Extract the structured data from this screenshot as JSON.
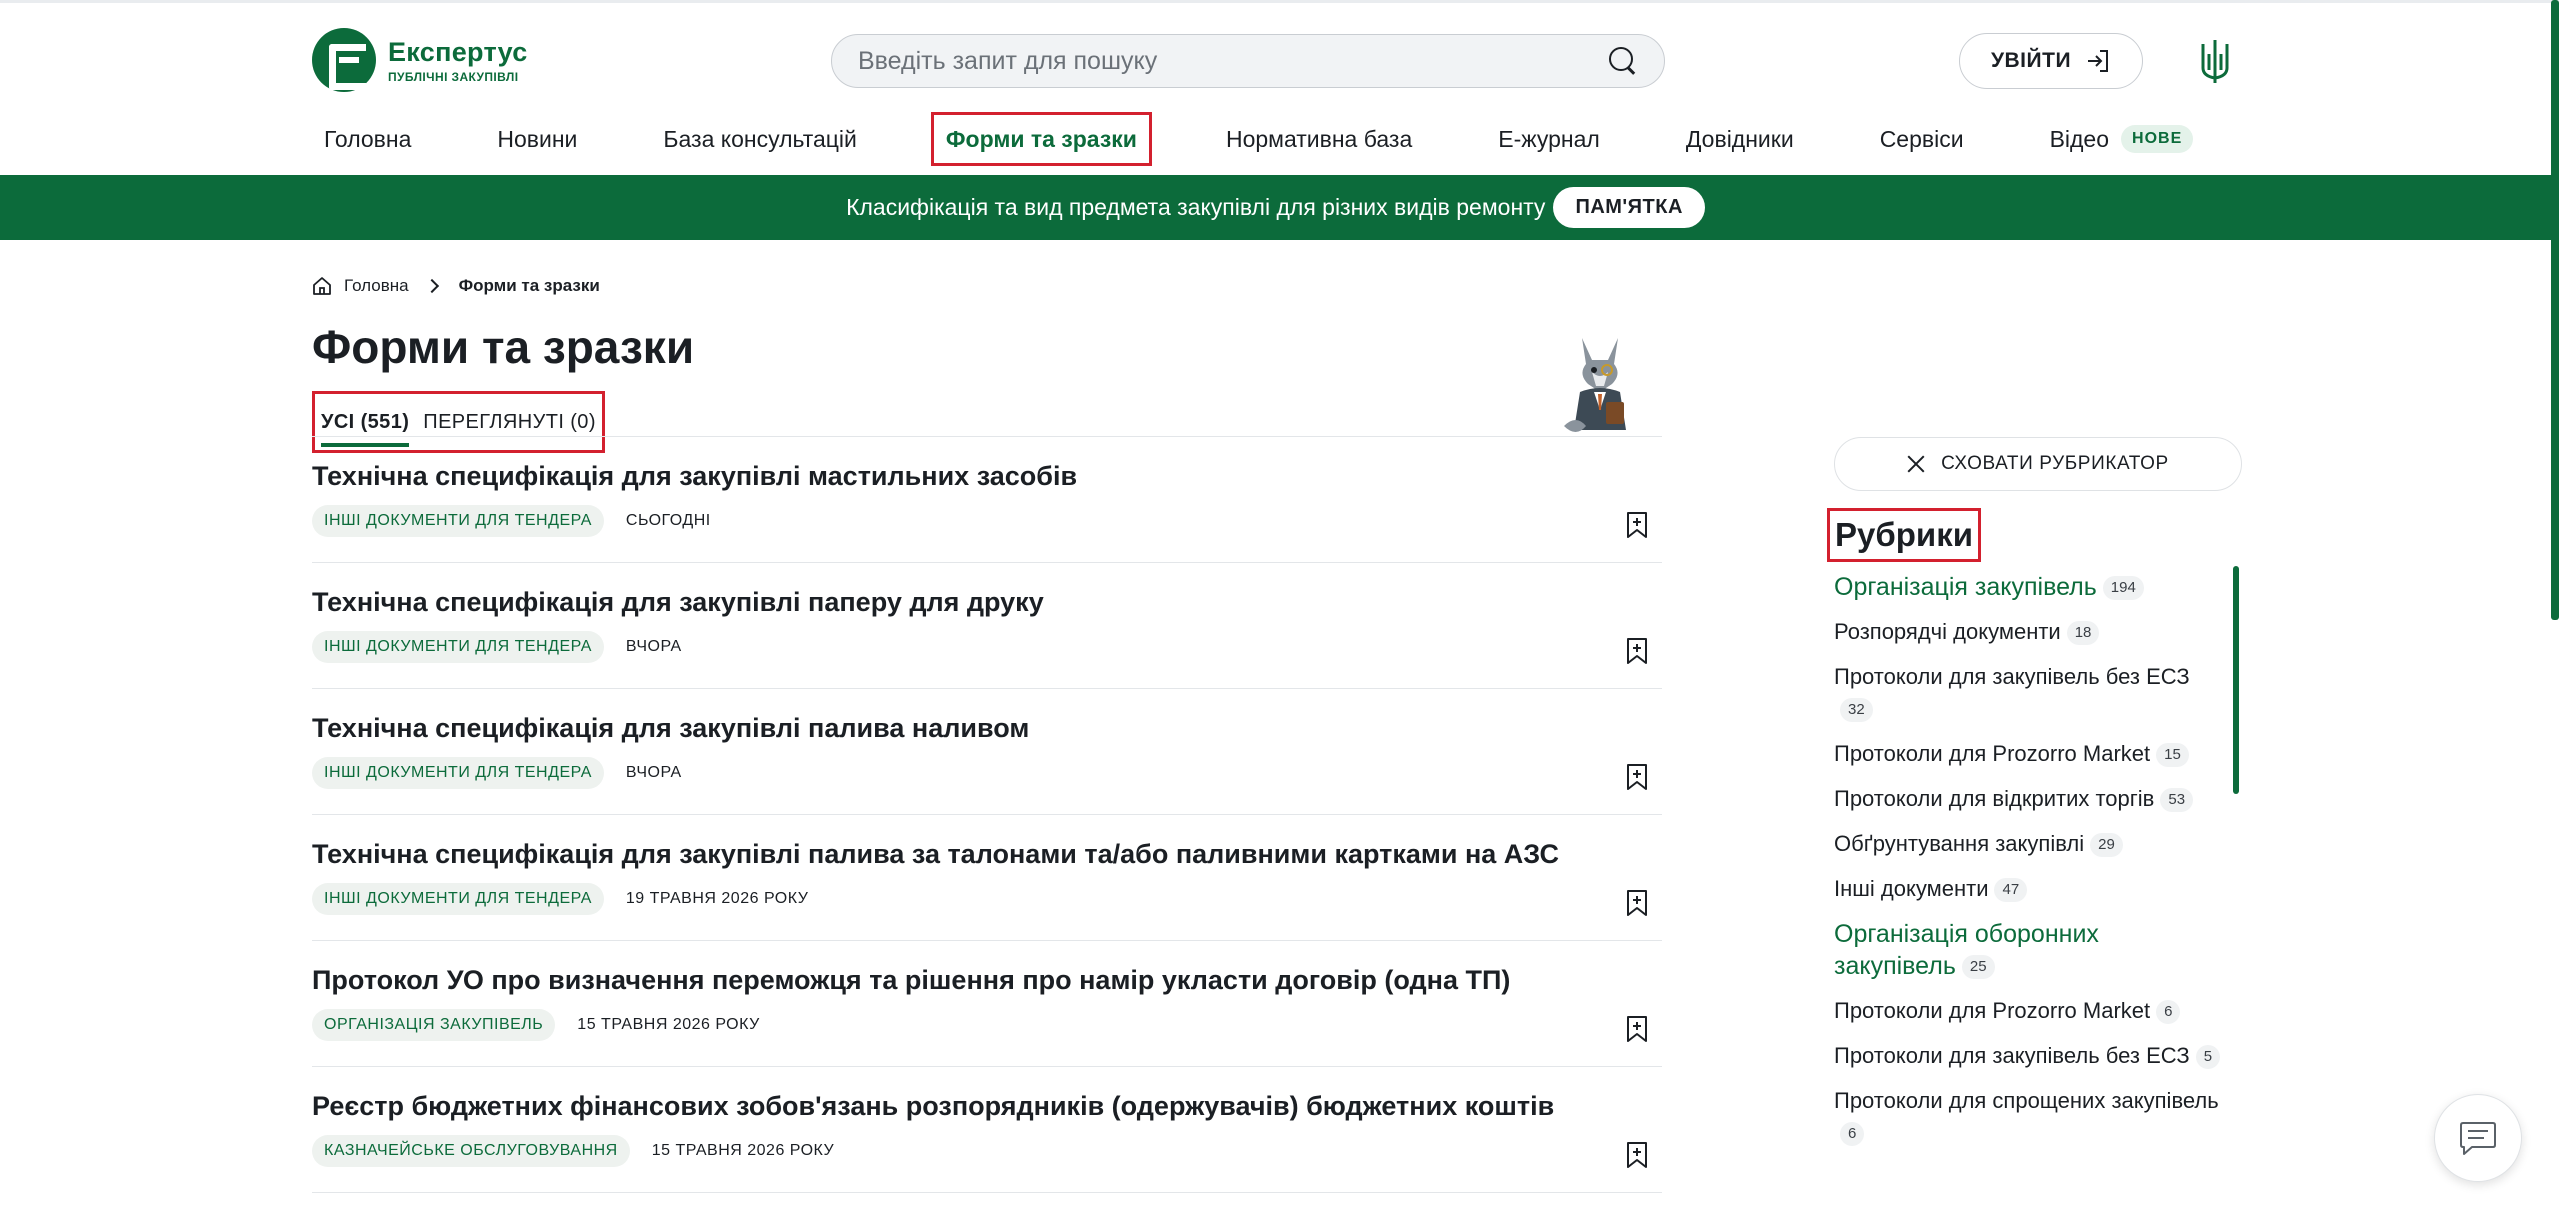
{
  "header": {
    "logo_title": "Експертус",
    "logo_subtitle": "ПУБЛІЧНІ ЗАКУПІВЛІ",
    "search_placeholder": "Введіть запит для пошуку",
    "login_label": "УВІЙТИ"
  },
  "nav": {
    "items": [
      "Головна",
      "Новини",
      "База консультацій",
      "Форми та зразки",
      "Нормативна база",
      "Е-журнал",
      "Довідники",
      "Сервіси",
      "Відео"
    ],
    "active_index": 3,
    "video_badge": "НОВЕ"
  },
  "banner": {
    "text": "Класифікація та вид предмета закупівлі для різних видів ремонту",
    "button": "ПАМ'ЯТКА"
  },
  "breadcrumb": {
    "home": "Головна",
    "current": "Форми та зразки"
  },
  "page": {
    "title": "Форми та зразки"
  },
  "tabs": [
    {
      "label": "УСІ (551)",
      "active": true
    },
    {
      "label": "ПЕРЕГЛЯНУТІ (0)",
      "active": false
    }
  ],
  "list": [
    {
      "title": "Технічна специфікація для закупівлі мастильних засобів",
      "tag": "ІНШІ ДОКУМЕНТИ ДЛЯ ТЕНДЕРА",
      "date": "СЬОГОДНІ"
    },
    {
      "title": "Технічна специфікація для закупівлі паперу для друку",
      "tag": "ІНШІ ДОКУМЕНТИ ДЛЯ ТЕНДЕРА",
      "date": "ВЧОРА"
    },
    {
      "title": "Технічна специфікація для закупівлі палива наливом",
      "tag": "ІНШІ ДОКУМЕНТИ ДЛЯ ТЕНДЕРА",
      "date": "ВЧОРА"
    },
    {
      "title": "Технічна специфікація для закупівлі палива за талонами та/або паливними картками на АЗС",
      "tag": "ІНШІ ДОКУМЕНТИ ДЛЯ ТЕНДЕРА",
      "date": "19 ТРАВНЯ 2026 РОКУ"
    },
    {
      "title": "Протокол УО про визначення переможця та рішення про намір укласти договір (одна ТП)",
      "tag": "ОРГАНІЗАЦІЯ ЗАКУПІВЕЛЬ",
      "date": "15 ТРАВНЯ 2026 РОКУ"
    },
    {
      "title": "Реєстр бюджетних фінансових зобов'язань розпорядників (одержувачів) бюджетних коштів",
      "tag": "КАЗНАЧЕЙСЬКЕ ОБСЛУГОВУВАННЯ",
      "date": "15 ТРАВНЯ 2026 РОКУ"
    }
  ],
  "sidebar": {
    "hide_label": "СХОВАТИ РУБРИКАТОР",
    "title": "Рубрики",
    "rubrics": [
      {
        "label": "Організація закупівель",
        "count": "194",
        "category": true
      },
      {
        "label": "Розпорядчі документи",
        "count": "18",
        "category": false
      },
      {
        "label": "Протоколи для закупівель без ЕСЗ",
        "count": "32",
        "category": false
      },
      {
        "label": "Протоколи для Prozorro Market",
        "count": "15",
        "category": false
      },
      {
        "label": "Протоколи для відкритих торгів",
        "count": "53",
        "category": false
      },
      {
        "label": "Обґрунтування закупівлі",
        "count": "29",
        "category": false
      },
      {
        "label": "Інші документи",
        "count": "47",
        "category": false
      },
      {
        "label": "Організація оборонних закупівель",
        "count": "25",
        "category": true
      },
      {
        "label": "Протоколи для Prozorro Market",
        "count": "6",
        "category": false
      },
      {
        "label": "Протоколи для закупівель без ЕСЗ",
        "count": "5",
        "category": false
      },
      {
        "label": "Протоколи для спрощених закупівель",
        "count": "6",
        "category": false
      }
    ]
  },
  "colors": {
    "brand": "#0c6b3b",
    "highlight": "#d3202e"
  }
}
